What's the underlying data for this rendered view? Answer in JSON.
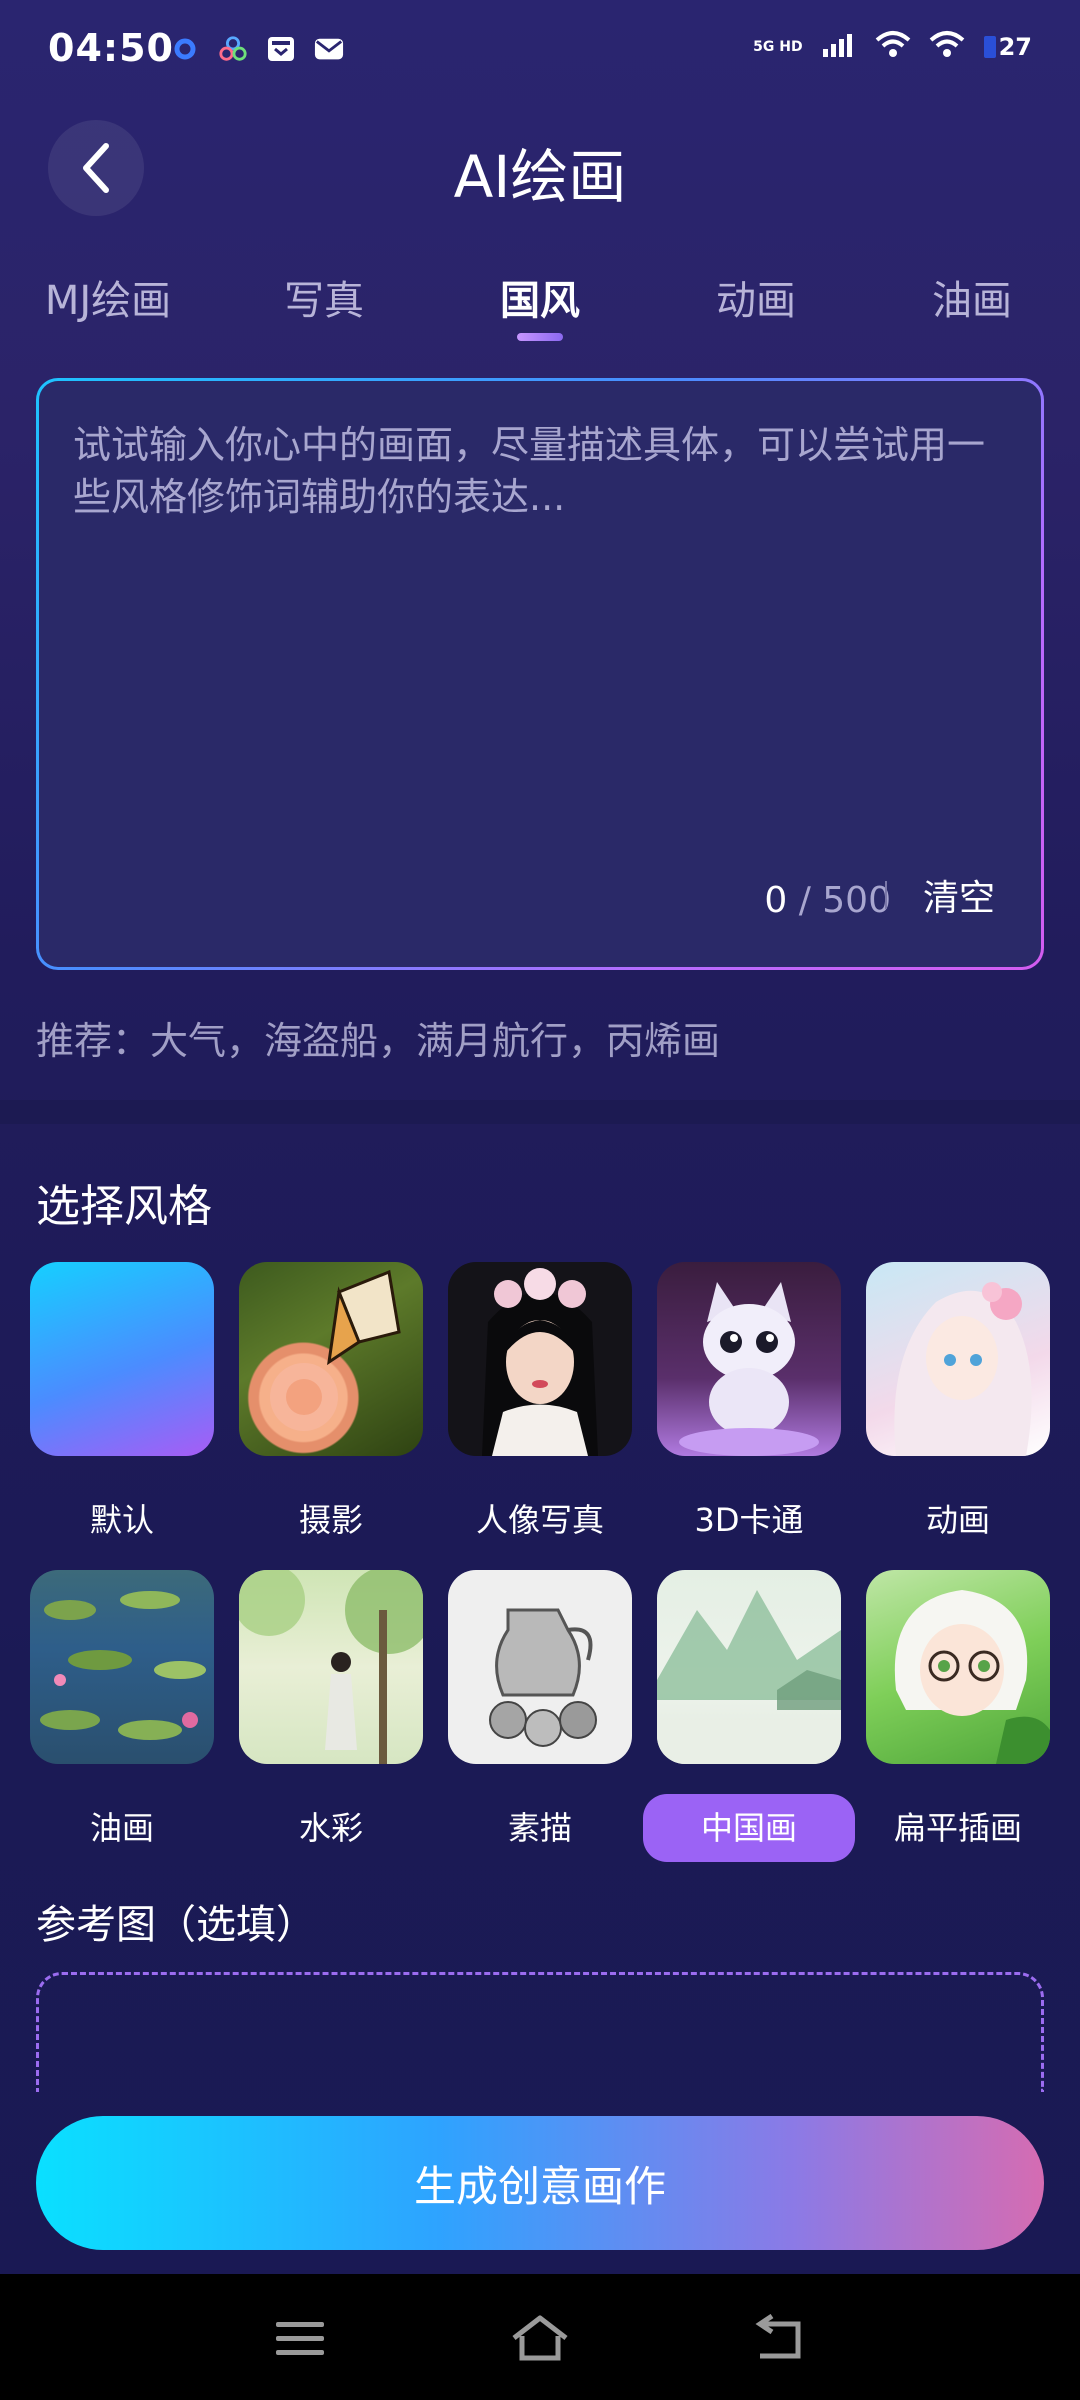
{
  "status_bar": {
    "time": "04:50",
    "network": "5G HD",
    "battery": "27"
  },
  "header": {
    "title": "AI绘画",
    "back_icon": "chevron-left-icon"
  },
  "tabs": [
    {
      "label": "MJ绘画",
      "active": false
    },
    {
      "label": "写真",
      "active": false
    },
    {
      "label": "国风",
      "active": true
    },
    {
      "label": "动画",
      "active": false
    },
    {
      "label": "油画",
      "active": false
    }
  ],
  "prompt": {
    "placeholder": "试试输入你心中的画面，尽量描述具体，可以尝试用一些风格修饰词辅助你的表达...",
    "count_current": "0",
    "count_max": "/ 500",
    "clear_label": "清空"
  },
  "recommend": "推荐：大气，海盗船，满月航行，丙烯画",
  "styles": {
    "title": "选择风格",
    "items": [
      {
        "label": "默认",
        "selected": false
      },
      {
        "label": "摄影",
        "selected": false
      },
      {
        "label": "人像写真",
        "selected": false
      },
      {
        "label": "3D卡通",
        "selected": false
      },
      {
        "label": "动画",
        "selected": false
      },
      {
        "label": "油画",
        "selected": false
      },
      {
        "label": "水彩",
        "selected": false
      },
      {
        "label": "素描",
        "selected": false
      },
      {
        "label": "中国画",
        "selected": true
      },
      {
        "label": "扁平插画",
        "selected": false
      }
    ]
  },
  "reference": {
    "title": "参考图（选填）"
  },
  "generate_button": "生成创意画作",
  "colors": {
    "accent": "#9b63f5",
    "background": "#211c5c"
  }
}
